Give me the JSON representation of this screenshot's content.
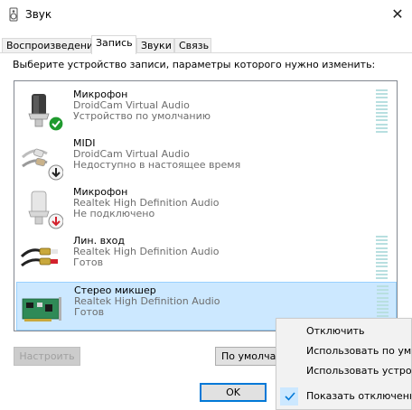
{
  "window": {
    "title": "Звук",
    "close_glyph": "✕"
  },
  "tabs": [
    {
      "label": "Воспроизведение",
      "active": false
    },
    {
      "label": "Запись",
      "active": true
    },
    {
      "label": "Звуки",
      "active": false
    },
    {
      "label": "Связь",
      "active": false
    }
  ],
  "instruction": "Выберите устройство записи, параметры которого нужно изменить:",
  "devices": [
    {
      "name": "Микрофон",
      "driver": "DroidCam Virtual Audio",
      "status": "Устройство по умолчанию",
      "icon": "microphone-icon",
      "badge": "default-check-badge-icon",
      "level_meter": true,
      "selected": false
    },
    {
      "name": "MIDI",
      "driver": "DroidCam Virtual Audio",
      "status": "Недоступно в настоящее время",
      "icon": "rca-cable-icon",
      "badge": "unavailable-arrow-badge-icon",
      "level_meter": false,
      "selected": false
    },
    {
      "name": "Микрофон",
      "driver": "Realtek High Definition Audio",
      "status": "Не подключено",
      "icon": "microphone-icon",
      "badge": "unplugged-arrow-badge-icon",
      "level_meter": false,
      "selected": false
    },
    {
      "name": "Лин. вход",
      "driver": "Realtek High Definition Audio",
      "status": "Готов",
      "icon": "rca-cable-icon",
      "badge": "",
      "level_meter": true,
      "selected": false
    },
    {
      "name": "Стерео микшер",
      "driver": "Realtek High Definition Audio",
      "status": "Готов",
      "icon": "sound-card-icon",
      "badge": "",
      "level_meter": true,
      "selected": true
    }
  ],
  "buttons": {
    "configure": "Настроить",
    "set_default": "По умолча",
    "ok": "OK"
  },
  "context_menu": {
    "items": [
      {
        "label": "Отключить",
        "checked": false
      },
      {
        "label": "Использовать по умо",
        "checked": false
      },
      {
        "label": "Использовать устрой",
        "checked": false
      },
      {
        "label": "Показать отключенны",
        "checked": true
      }
    ]
  },
  "colors": {
    "selection_bg": "#cce8ff",
    "selection_border": "#99d1ff",
    "level_meter": "#b8dfe0",
    "accent": "#0078d7",
    "check_green": "#1f9a2e",
    "arrow_red": "#d3212d"
  }
}
